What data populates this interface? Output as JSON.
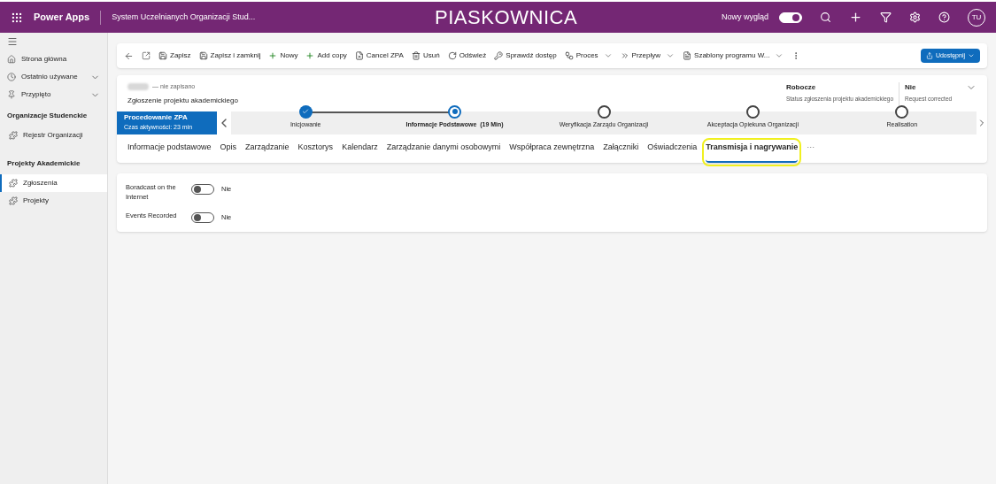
{
  "topbar": {
    "app_name": "Power Apps",
    "app_title": "System Uczelnianych Organizacji Stud...",
    "environment": "PIASKOWNICA",
    "new_look": {
      "label": "Nowy wygląd",
      "on": true
    },
    "avatar": "TU"
  },
  "sidebar": {
    "entries": [
      {
        "kind": "link",
        "label": "Strona główna"
      },
      {
        "kind": "expander",
        "label": "Ostatnio używane",
        "expanded": false
      },
      {
        "kind": "expander",
        "label": "Przypięto",
        "expanded": false
      },
      {
        "kind": "heading",
        "label": "Organizacje Studenckie"
      },
      {
        "kind": "nav",
        "label": "Rejestr Organizacji",
        "selected": false
      },
      {
        "kind": "heading",
        "label": "Projekty Akademickie"
      },
      {
        "kind": "nav",
        "label": "Zgłoszenia",
        "selected": true
      },
      {
        "kind": "nav",
        "label": "Projekty",
        "selected": false
      }
    ]
  },
  "toolbar": {
    "commands": [
      {
        "label": "Zapisz",
        "menu": false
      },
      {
        "label": "Zapisz i zamknij",
        "menu": false
      },
      {
        "label": "Nowy",
        "menu": false
      },
      {
        "label": "Add copy",
        "menu": false
      },
      {
        "label": "Cancel ZPA",
        "menu": false
      },
      {
        "label": "Usuń",
        "menu": false
      },
      {
        "label": "Odśwież",
        "menu": false
      },
      {
        "label": "Sprawdź dostęp",
        "menu": false
      },
      {
        "label": "Proces",
        "menu": true
      },
      {
        "label": "Przepływ",
        "menu": true
      },
      {
        "label": "Szablony programu W...",
        "menu": true
      }
    ],
    "share": "Udostępnij"
  },
  "record": {
    "save_state": "— nie zapisano",
    "entity": "Zgłoszenie projektu akademickiego",
    "header_fields": [
      {
        "value": "Robocze",
        "label": "Status zgłoszenia projektu akademickiego"
      },
      {
        "value": "Nie",
        "label": "Request corrected"
      }
    ],
    "process": {
      "name": "Procedowanie ZPA",
      "duration": "Czas aktywności: 23 min",
      "stages": [
        {
          "label": "Inicjowanie",
          "kind": "done"
        },
        {
          "label": "Informacje Podstawowe  (19 Min)",
          "kind": "active"
        },
        {
          "label": "Weryfikacja Zarządu Organizacji",
          "kind": "pending"
        },
        {
          "label": "Akceptacja Opiekuna Organizacji",
          "kind": "pending"
        },
        {
          "label": "Realisation",
          "kind": "pending"
        }
      ]
    },
    "tabs": [
      {
        "label": "Informacje podstawowe",
        "selected": false
      },
      {
        "label": "Opis",
        "selected": false
      },
      {
        "label": "Zarządzanie",
        "selected": false
      },
      {
        "label": "Kosztorys",
        "selected": false
      },
      {
        "label": "Kalendarz",
        "selected": false
      },
      {
        "label": "Zarządzanie danymi osobowymi",
        "selected": false
      },
      {
        "label": "Współpraca zewnętrzna",
        "selected": false
      },
      {
        "label": "Załączniki",
        "selected": false
      },
      {
        "label": "Oświadczenia",
        "selected": false
      },
      {
        "label": "Transmisja i nagrywanie",
        "selected": true
      }
    ],
    "more_tabs": "···"
  },
  "form": {
    "fields": [
      {
        "label": "Boradcast on the Internet",
        "on": false,
        "value": "Nie"
      },
      {
        "label": "Events Recorded",
        "on": false,
        "value": "Nie"
      }
    ]
  }
}
